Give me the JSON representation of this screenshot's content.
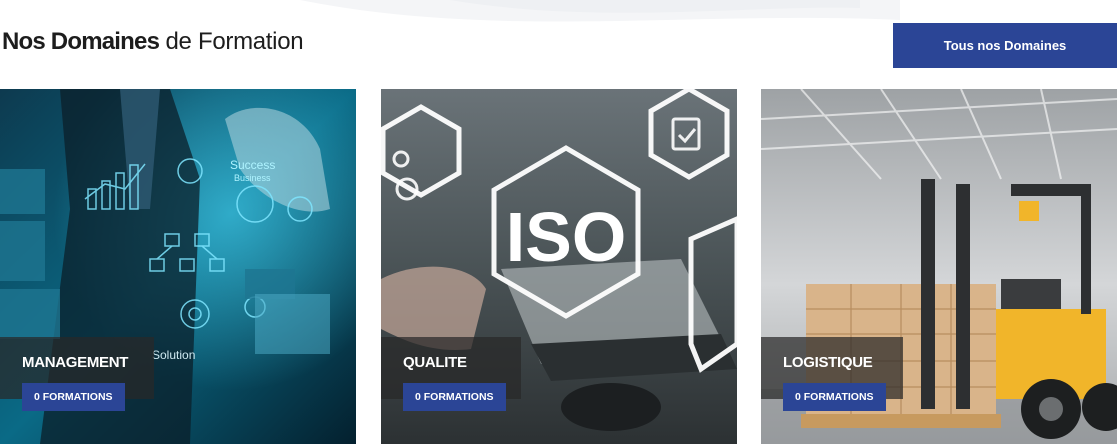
{
  "heading": {
    "bold": "Nos Domaines",
    "rest": "de Formation"
  },
  "all_domains_button": "Tous nos Domaines",
  "accent_color": "#2b4596",
  "cards": [
    {
      "title": "MANAGEMENT",
      "badge": "0 FORMATIONS",
      "image": "business-man-drawing-diagrams",
      "image_text": {
        "success": "Success",
        "business": "Business",
        "solution": "Solution"
      }
    },
    {
      "title": "QUALITE",
      "badge": "0 FORMATIONS",
      "image": "iso-hexagon-laptop",
      "image_text": {
        "iso": "ISO"
      }
    },
    {
      "title": "LOGISTIQUE",
      "badge": "0 FORMATIONS",
      "image": "forklift-warehouse-boxes"
    }
  ]
}
